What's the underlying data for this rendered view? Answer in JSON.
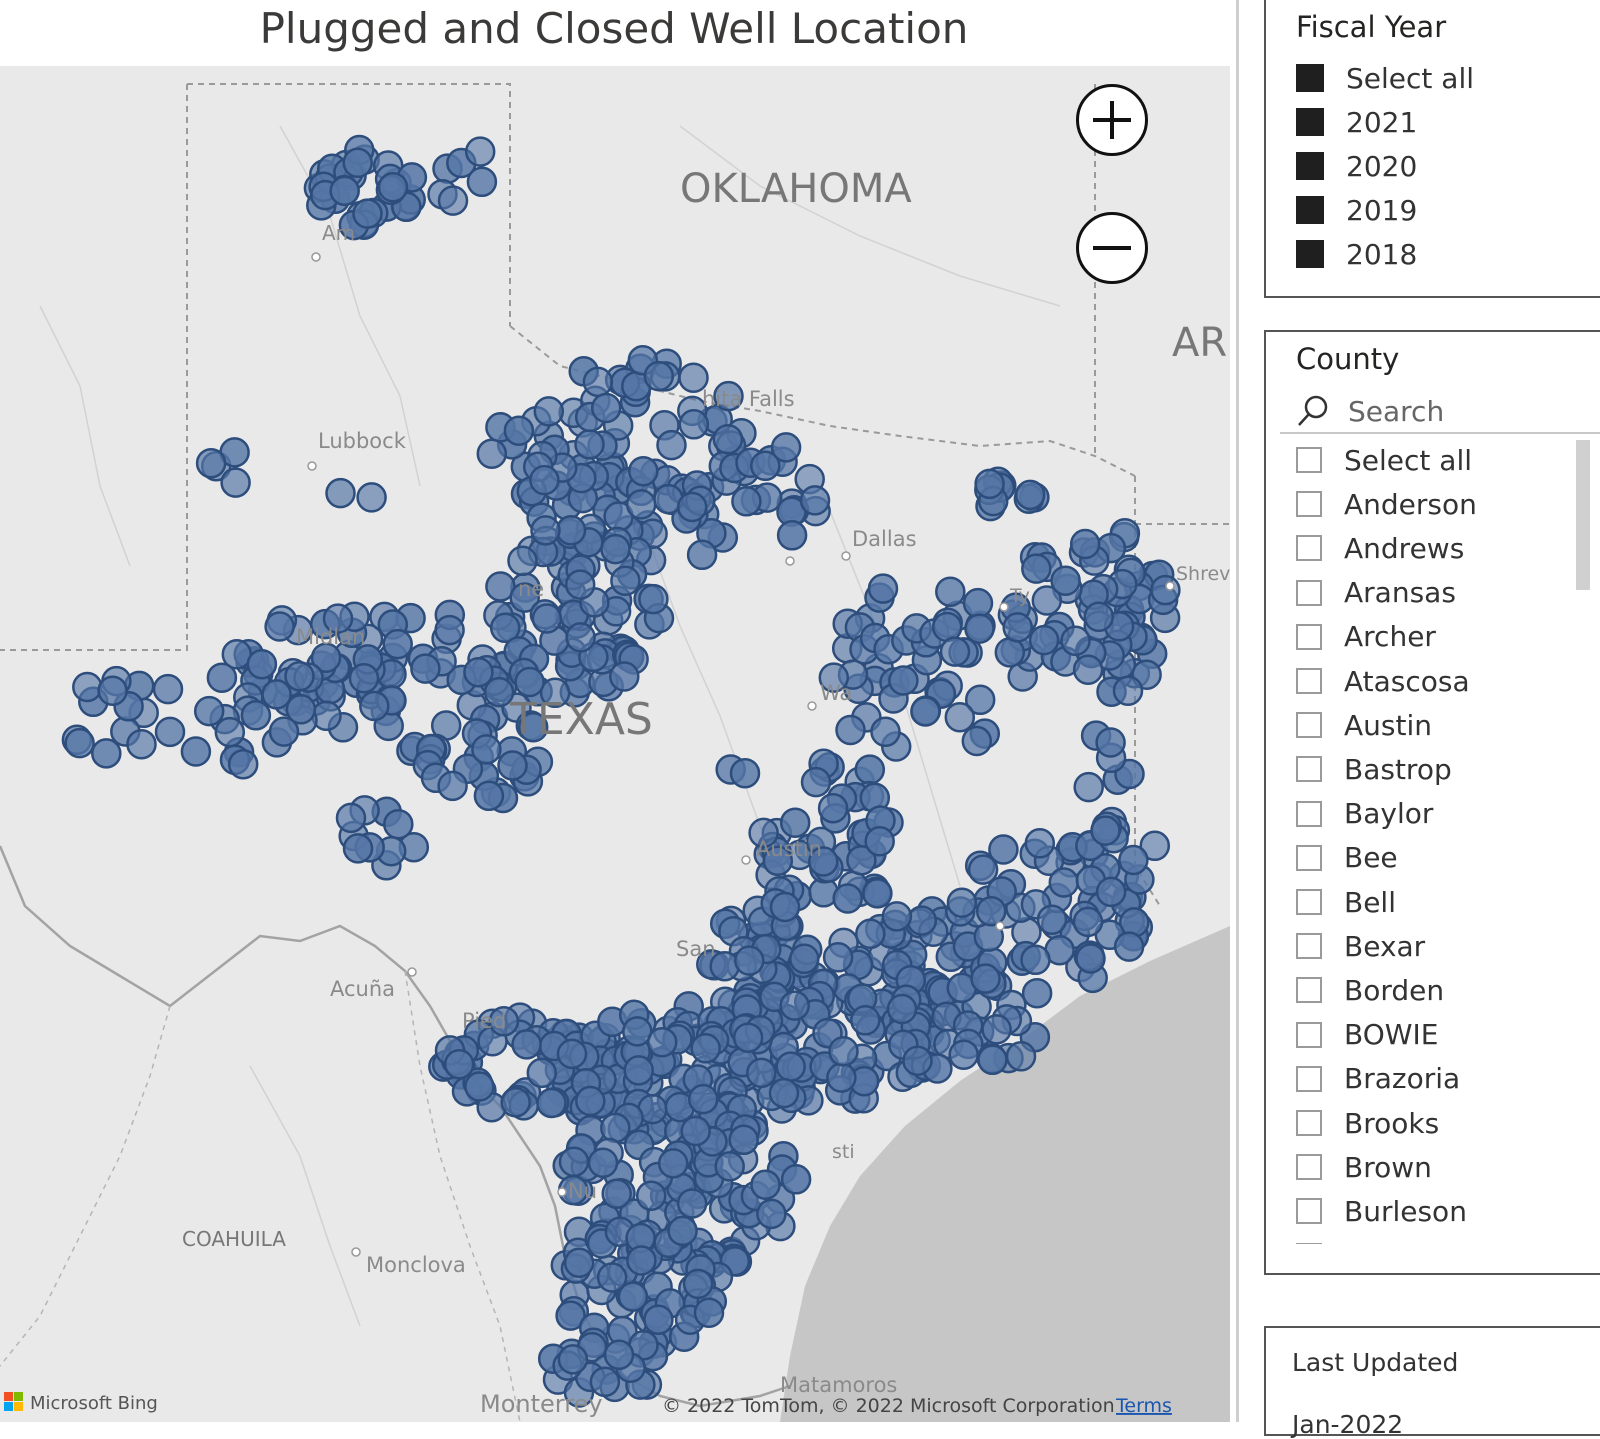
{
  "title": "Plugged and Closed Well Location",
  "map": {
    "labels": {
      "state_main": "TEXAS",
      "state_north": "OKLAHOMA",
      "state_ne": "AR",
      "coahuila": "COAHUILA",
      "amarillo": "Am",
      "lubbock": "Lubbock",
      "wichita": "hita Falls",
      "dallas": "Dallas",
      "shreveport": "Shrev",
      "tyler": "Ty",
      "midland": "Midlan",
      "abilene": "ne",
      "waco": "Wa",
      "austin": "Austin",
      "san_antonio": "San",
      "acuna": "Acuña",
      "piedras": "Pied",
      "nuevo_laredo": "Nu",
      "corpus": "sti",
      "monclova": "Monclova",
      "matamoros": "Matamoros",
      "monterrey": "Monterrey"
    },
    "attribution": "© 2022 TomTom, © 2022 Microsoft Corporation",
    "terms": "Terms",
    "bing": "Microsoft Bing",
    "marker_color": "#5576a6",
    "marker_stroke": "#2d4d7c",
    "zoom_in_label": "zoom in",
    "zoom_out_label": "zoom out"
  },
  "fiscal_year": {
    "title": "Fiscal Year",
    "items": [
      "Select all",
      "2021",
      "2020",
      "2019",
      "2018"
    ]
  },
  "county": {
    "title": "County",
    "search_placeholder": "Search",
    "items": [
      "Select all",
      "Anderson",
      "Andrews",
      "Aransas",
      "Archer",
      "Atascosa",
      "Austin",
      "Bastrop",
      "Baylor",
      "Bee",
      "Bell",
      "Bexar",
      "Borden",
      "BOWIE",
      "Brazoria",
      "Brooks",
      "Brown",
      "Burleson",
      "Caldwell"
    ]
  },
  "last_updated": {
    "title": "Last Updated",
    "value": "Jan-2022"
  }
}
